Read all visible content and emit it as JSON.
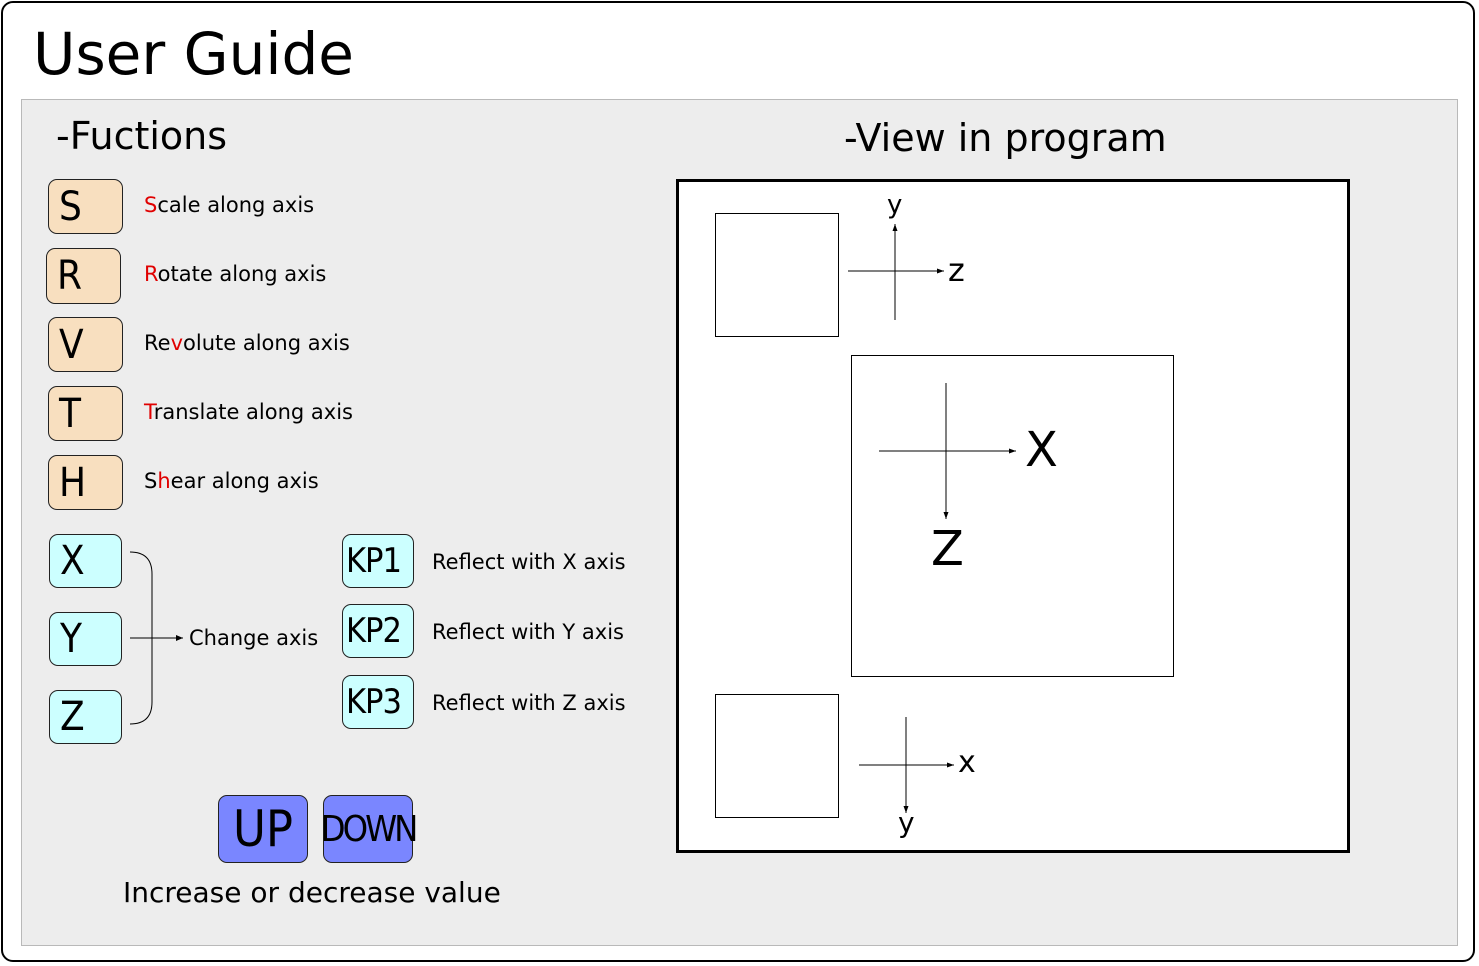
{
  "title": "User Guide",
  "functions": {
    "heading": "-Fuctions",
    "keys": [
      {
        "key": "S",
        "pre": "",
        "hl": "S",
        "post": "cale along axis"
      },
      {
        "key": "R",
        "pre": "",
        "hl": "R",
        "post": "otate along axis"
      },
      {
        "key": "V",
        "pre": "Re",
        "hl": "v",
        "post": "olute along axis"
      },
      {
        "key": "T",
        "pre": "",
        "hl": "T",
        "post": "ranslate along axis"
      },
      {
        "key": "H",
        "pre": "S",
        "hl": "h",
        "post": "ear along axis"
      }
    ],
    "axis_keys": [
      "X",
      "Y",
      "Z"
    ],
    "axis_label": "Change axis",
    "reflect": [
      {
        "key": "KP1",
        "label": "Reflect with X axis"
      },
      {
        "key": "KP2",
        "label": "Reflect with Y axis"
      },
      {
        "key": "KP3",
        "label": "Reflect with Z axis"
      }
    ],
    "up_key": "UP",
    "down_key": "DOWN",
    "value_label": "Increase or decrease value"
  },
  "view": {
    "heading": "-View in program",
    "top_view": {
      "vertical": "y",
      "horizontal": "z"
    },
    "main_view": {
      "horizontal": "X",
      "vertical": "Z"
    },
    "bottom_view": {
      "horizontal": "x",
      "vertical": "y"
    }
  },
  "colors": {
    "function_key": "#f8dfbf",
    "axis_key": "#ccffff",
    "value_key": "#7a86ff",
    "highlight": "#e00000",
    "panel": "#ededed"
  }
}
